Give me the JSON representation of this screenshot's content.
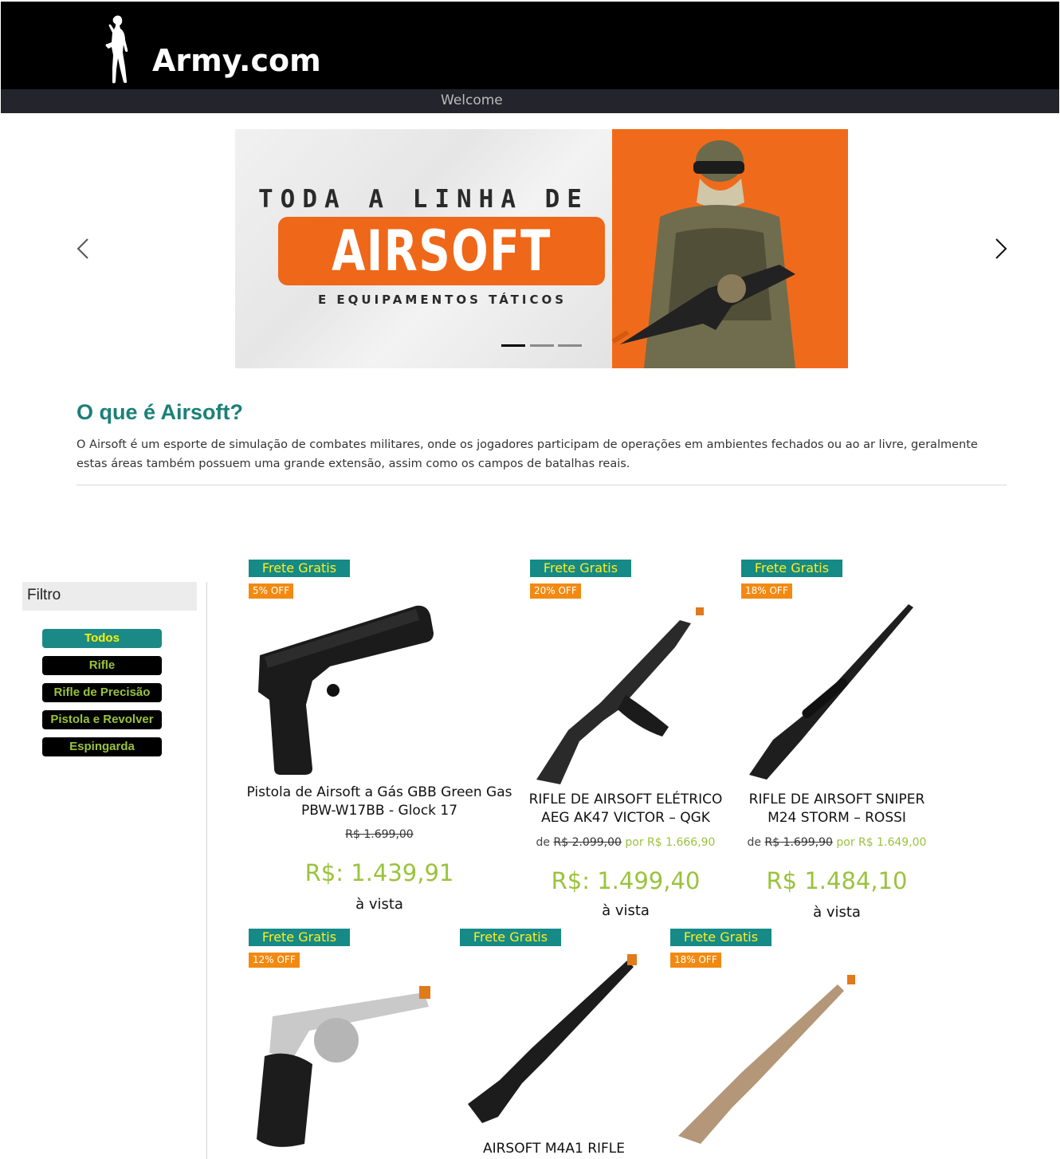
{
  "header": {
    "brand": "Army.com"
  },
  "nav": {
    "welcome": "Welcome"
  },
  "banner": {
    "line1": "TODA A LINHA DE",
    "headline": "AIRSOFT",
    "line3": "E EQUIPAMENTOS TÁTICOS",
    "slides": 3,
    "active_slide": 1
  },
  "intro": {
    "title": "O que é Airsoft?",
    "text": "O Airsoft é um esporte de simulação de combates militares, onde os jogadores participam de operações em ambientes fechados ou ao ar livre, geralmente estas áreas também possuem uma grande extensão, assim como os campos de batalhas reais."
  },
  "filter": {
    "title": "Filtro",
    "options": [
      "Todos",
      "Rifle",
      "Rifle de Precisão",
      "Pistola e Revolver",
      "Espingarda"
    ],
    "selected": "Todos"
  },
  "products": [
    {
      "tag": "Frete Gratis",
      "discount": "5% OFF",
      "name": "Pistola de Airsoft a Gás GBB Green Gas PBW-W17BB - Glock 17",
      "old_price": "R$ 1.699,00",
      "price": "R$: 1.439,91",
      "note": "à vista"
    },
    {
      "tag": "Frete Gratis",
      "discount": "20% OFF",
      "name": "RIFLE DE AIRSOFT ELÉTRICO AEG AK47 VICTOR – QGK",
      "de": "de",
      "old_price": "R$ 2.099,00",
      "por": "por R$ 1.666,90",
      "price": "R$: 1.499,40",
      "note": "à vista"
    },
    {
      "tag": "Frete Gratis",
      "discount": "18% OFF",
      "name": "RIFLE DE AIRSOFT SNIPER M24 STORM – ROSSI",
      "de": "de",
      "old_price": "R$ 1.699,90",
      "por": "por R$ 1.649,00",
      "price": "R$ 1.484,10",
      "note": "à vista"
    },
    {
      "tag": "Frete Gratis",
      "discount": "12% OFF"
    },
    {
      "tag": "Frete Gratis",
      "name": "AIRSOFT M4A1 RIFLE"
    },
    {
      "tag": "Frete Gratis",
      "discount": "18% OFF"
    }
  ],
  "colors": {
    "accent": "#1b8077",
    "price": "#9ac33c",
    "badge": "#f28a12",
    "tag": "#168a86"
  }
}
